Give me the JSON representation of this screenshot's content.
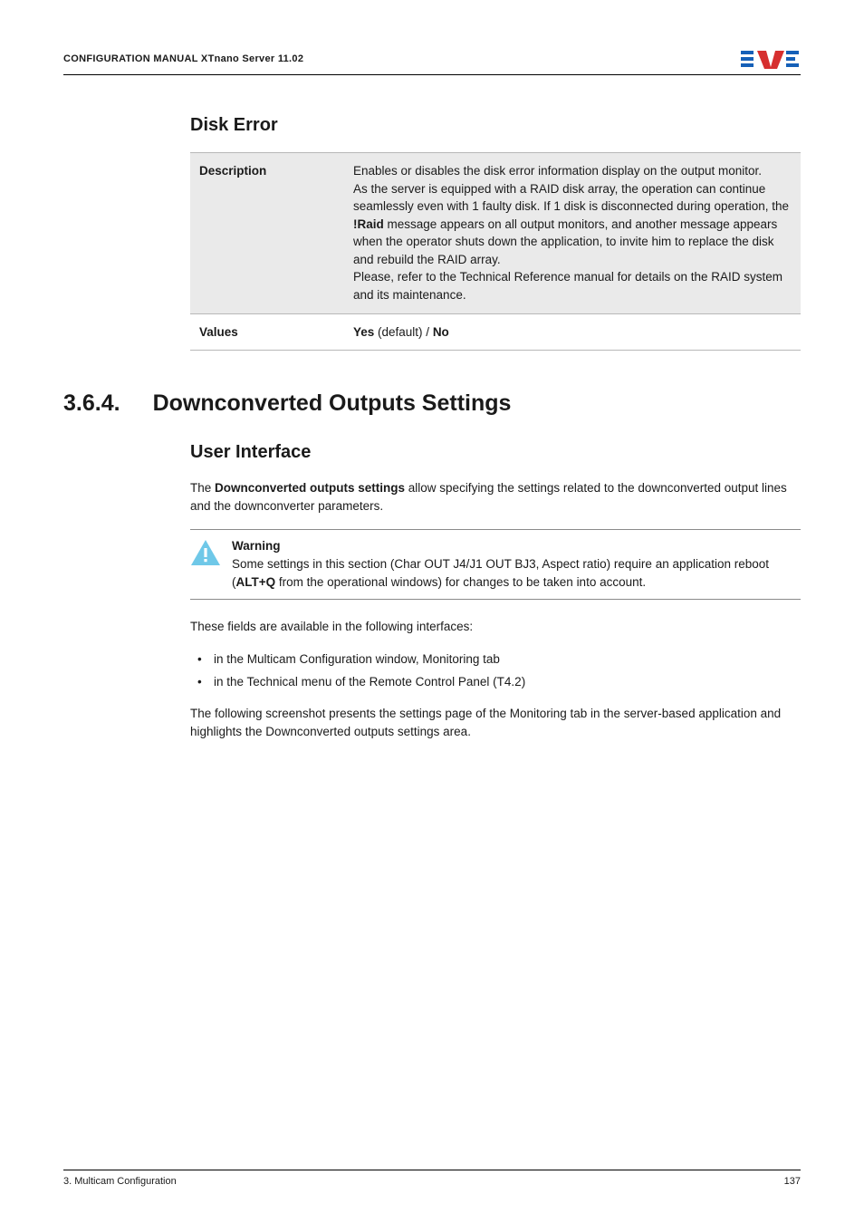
{
  "header": {
    "title": "CONFIGURATION MANUAL  XTnano Server 11.02"
  },
  "disk_error": {
    "heading": "Disk Error",
    "rows": [
      {
        "label": "Description",
        "value_html": "Enables or disables the disk error information display on the output monitor.<br>As the server is equipped with a RAID disk array, the operation can continue seamlessly even with 1 faulty disk. If 1 disk is disconnected during operation, the <b>!Raid</b> message appears on all output monitors, and another message appears when the operator shuts down the application, to invite him to replace the disk and rebuild the RAID array.<br>Please, refer to the Technical Reference manual for details on the RAID system and its maintenance."
      },
      {
        "label": "Values",
        "value_html": "<b>Yes</b> (default) / <b>No</b>"
      }
    ]
  },
  "section": {
    "number": "3.6.4.",
    "title": "Downconverted Outputs Settings",
    "sub_heading": "User Interface",
    "intro_html": "The <b>Downconverted outputs settings</b> allow specifying the settings related to the downconverted output lines and the downconverter parameters.",
    "warning": {
      "label": "Warning",
      "body_html": "Some settings in this section (Char OUT J4/J1 OUT BJ3, Aspect ratio) require an application reboot (<b>ALT+Q</b> from the operational windows) for changes to be taken into account."
    },
    "after_warning": "These fields are available in the following interfaces:",
    "bullets": [
      "in the Multicam Configuration window, Monitoring tab",
      "in the Technical menu of the Remote Control Panel (T4.2)"
    ],
    "closing": "The following screenshot presents the settings page of the Monitoring tab in the server-based application and highlights the Downconverted outputs settings area."
  },
  "footer": {
    "left": "3. Multicam Configuration",
    "right": "137"
  }
}
